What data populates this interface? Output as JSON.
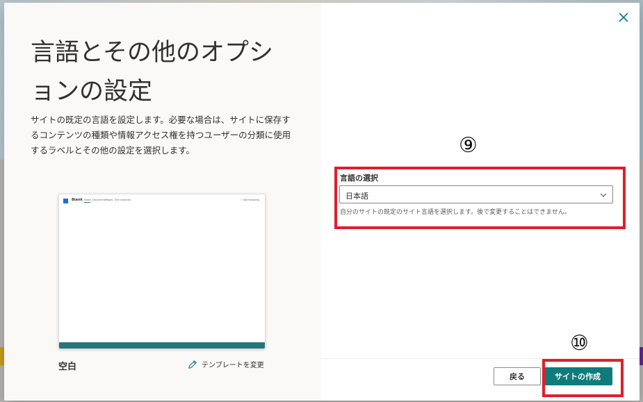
{
  "dialog": {
    "title": "言語とその他のオプションの設定",
    "description": "サイトの既定の言語を設定します。必要な場合は、サイトに保存するコンテンツの種類や情報アクセス権を持つユーザーの分類に使用するラベルとその他の設定を選択します。"
  },
  "template": {
    "name": "空白",
    "change_label": "テンプレートを変更",
    "preview": {
      "site_title": "Blank",
      "nav": [
        "Home",
        "Documents",
        "Pages",
        "Site contents"
      ],
      "follow": "☆ Not following"
    }
  },
  "annotations": {
    "step_9": "⑨",
    "step_10": "⑩"
  },
  "language": {
    "label": "言語の選択",
    "selected": "日本語",
    "help": "自分のサイトの既定のサイト言語を選択します。後で変更することはできません。"
  },
  "buttons": {
    "back": "戻る",
    "create": "サイトの作成"
  },
  "colors": {
    "accent": "#0f7b7a",
    "highlight": "#e21d2b",
    "preview_bar": "#287578"
  }
}
